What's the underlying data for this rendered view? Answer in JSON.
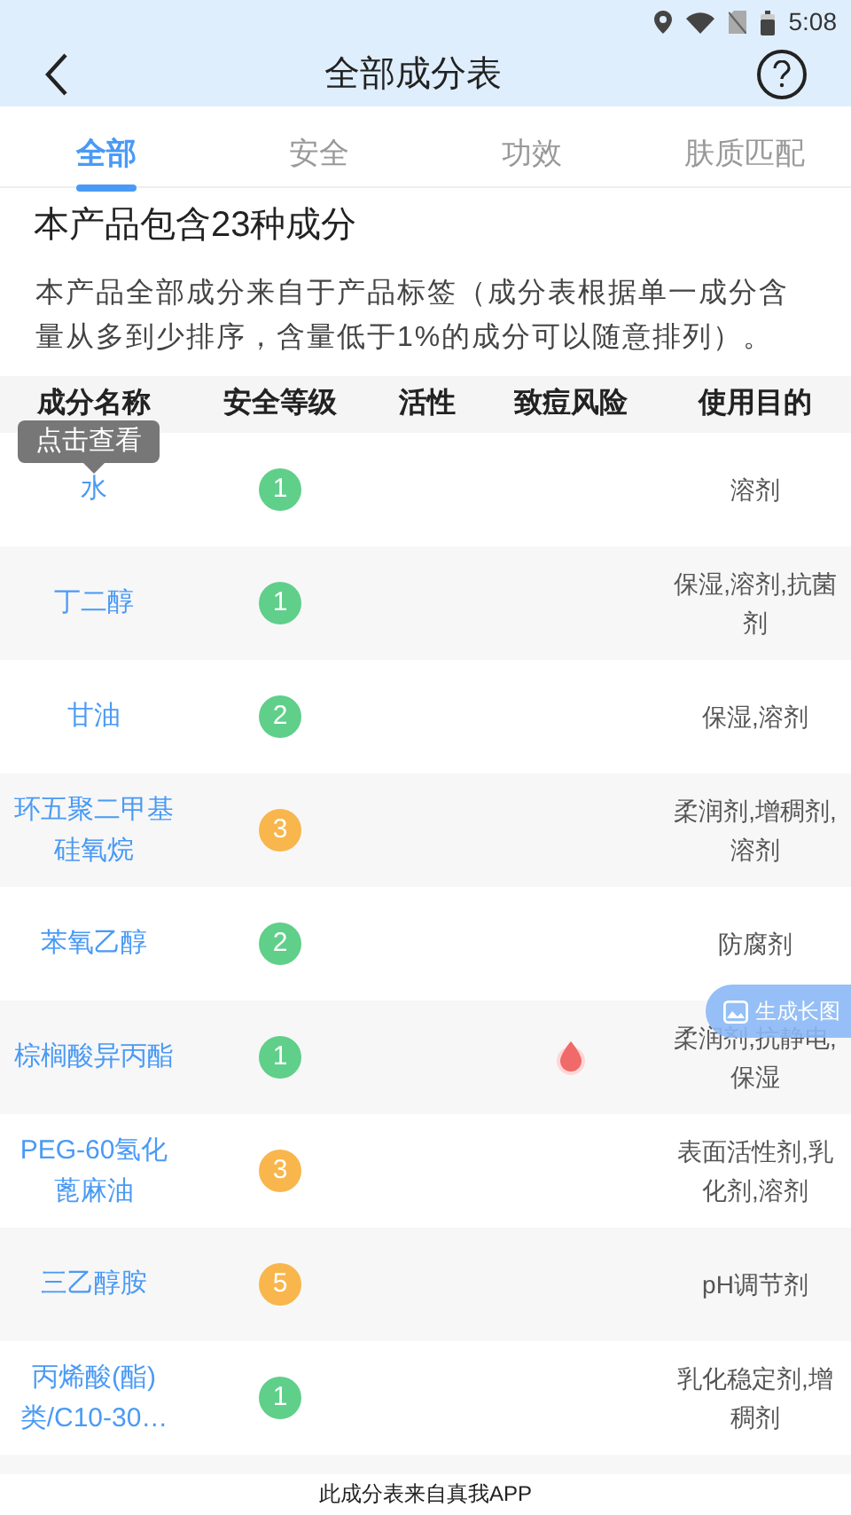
{
  "status_bar": {
    "time": "5:08"
  },
  "header": {
    "title": "全部成分表"
  },
  "tabs": [
    {
      "label": "全部",
      "selected": true
    },
    {
      "label": "安全",
      "selected": false
    },
    {
      "label": "功效",
      "selected": false
    },
    {
      "label": "肤质匹配",
      "selected": false
    }
  ],
  "summary": "本产品包含23种成分",
  "description": "本产品全部成分来自于产品标签（成分表根据单一成分含量从多到少排序，含量低于1%的成分可以随意排列）。",
  "table": {
    "columns": [
      "成分名称",
      "安全等级",
      "活性",
      "致痘风险",
      "使用目的"
    ],
    "tooltip": "点击查看",
    "rows": [
      {
        "name": "水",
        "safety": "1",
        "color": "#5fcf8a",
        "acne_risk": false,
        "purpose": "溶剂"
      },
      {
        "name": "丁二醇",
        "safety": "1",
        "color": "#5fcf8a",
        "acne_risk": false,
        "purpose": "保湿,溶剂,抗菌剂"
      },
      {
        "name": "甘油",
        "safety": "2",
        "color": "#5fcf8a",
        "acne_risk": false,
        "purpose": "保湿,溶剂"
      },
      {
        "name": "环五聚二甲基硅氧烷",
        "safety": "3",
        "color": "#f8b64c",
        "acne_risk": false,
        "purpose": "柔润剂,增稠剂,溶剂"
      },
      {
        "name": "苯氧乙醇",
        "safety": "2",
        "color": "#5fcf8a",
        "acne_risk": false,
        "purpose": "防腐剂"
      },
      {
        "name": "棕榈酸异丙酯",
        "safety": "1",
        "color": "#5fcf8a",
        "acne_risk": true,
        "purpose": "柔润剂,抗静电,保湿"
      },
      {
        "name": "PEG-60氢化蓖麻油",
        "safety": "3",
        "color": "#f8b64c",
        "acne_risk": false,
        "purpose": "表面活性剂,乳化剂,溶剂"
      },
      {
        "name": "三乙醇胺",
        "safety": "5",
        "color": "#f8b64c",
        "acne_risk": false,
        "purpose": "pH调节剂"
      },
      {
        "name": "丙烯酸(酯)类/C10-30…",
        "safety": "1",
        "color": "#5fcf8a",
        "acne_risk": false,
        "purpose": "乳化稳定剂,增稠剂"
      }
    ]
  },
  "float_button": {
    "label": "生成长图"
  },
  "footer": "此成分表来自真我APP"
}
